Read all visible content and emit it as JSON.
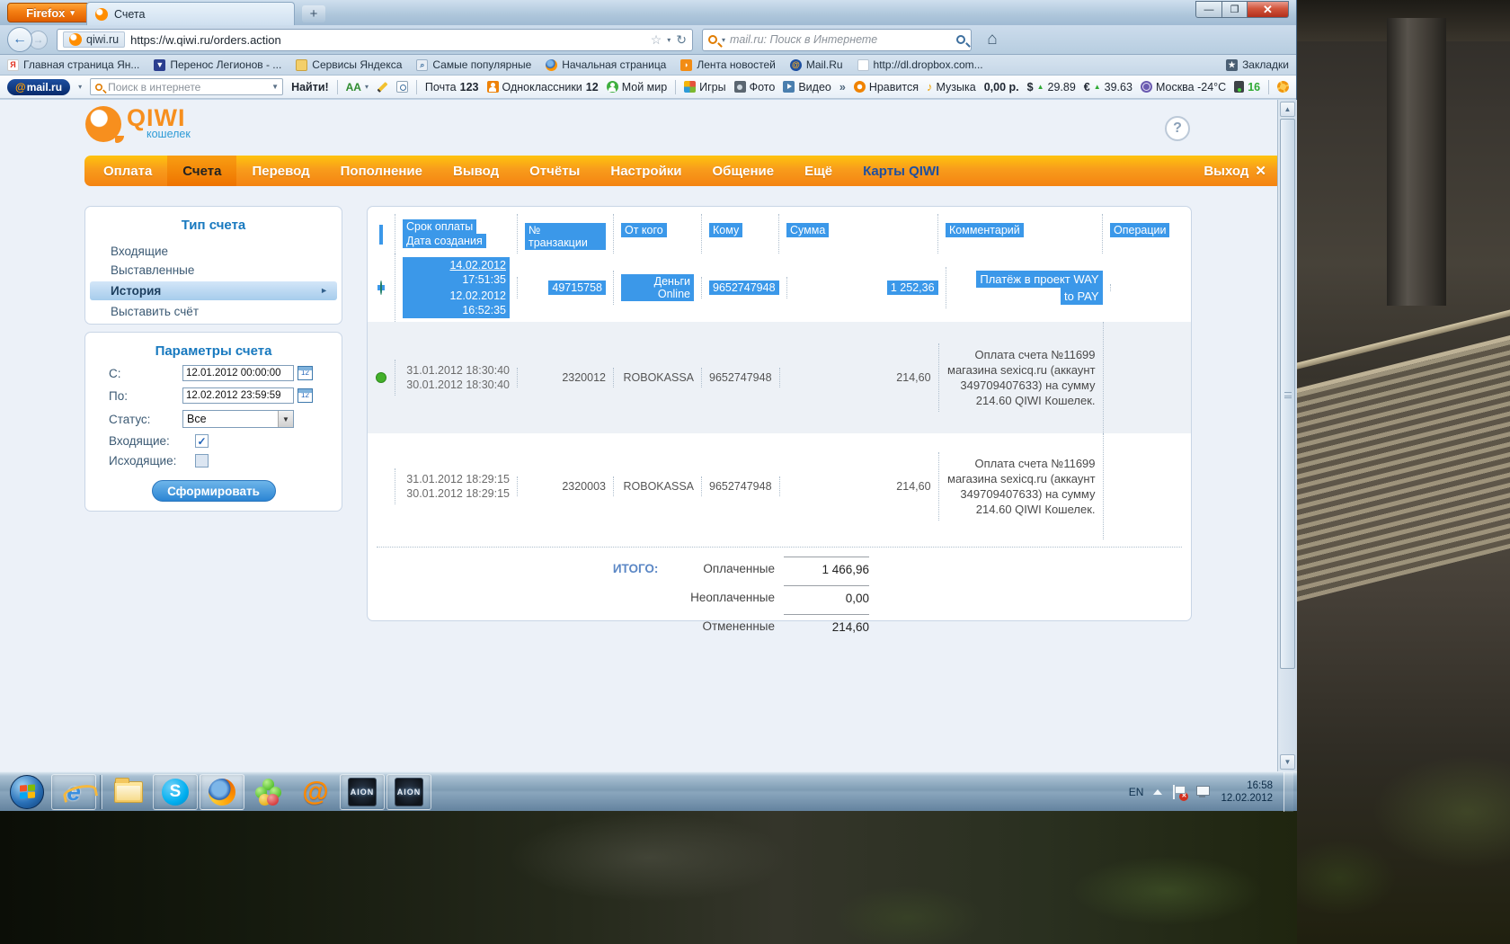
{
  "browser": {
    "menu_button": "Firefox",
    "menu_caret": "▾",
    "tab_title": "Счета",
    "new_tab": "+",
    "win_min": "—",
    "win_max": "❐",
    "win_close": "✕",
    "back": "←",
    "forward": "→",
    "url_domain": "qiwi.ru",
    "url_path": "https://w.qiwi.ru/orders.action",
    "star": "☆",
    "reload": "↻",
    "search_placeholder": "mail.ru: Поиск в Интернете",
    "home": "⌂",
    "bookmarks": [
      "Главная страница Ян...",
      "Перенос Легионов - ...",
      "Сервисы Яндекса",
      "Самые популярные",
      "Начальная страница",
      "Лента новостей",
      "Mail.Ru",
      "http://dl.dropbox.com..."
    ],
    "bookmarks_button": "Закладки"
  },
  "mailbar": {
    "logo_at": "@",
    "logo_rest": "mail.ru",
    "search_placeholder": "Поиск в интернете",
    "find": "Найти!",
    "font_icon": "AА",
    "mail": "Почта",
    "mail_count": "123",
    "ok": "Одноклассники",
    "ok_count": "12",
    "world": "Мой мир",
    "games": "Игры",
    "photo": "Фото",
    "video": "Видео",
    "more": "»",
    "like": "Нравится",
    "music": "Музыка",
    "music_note": "♪",
    "balance": "0,00 р.",
    "usd_sign": "$",
    "usd_up": "▲",
    "usd": "29.89",
    "eur_sign": "€",
    "eur_up": "▲",
    "eur": "39.63",
    "weather": "Москва -24°C",
    "traffic": "16"
  },
  "page": {
    "logo": "QIWI",
    "logo_sub": "кошелек",
    "help": "?",
    "nav": [
      "Оплата",
      "Счета",
      "Перевод",
      "Пополнение",
      "Вывод",
      "Отчёты",
      "Настройки",
      "Общение",
      "Ещё",
      "Карты QIWI"
    ],
    "logout": "Выход",
    "logout_x": "✕",
    "sidebar": {
      "type_title": "Тип счета",
      "type_items": [
        "Входящие",
        "Выставленные",
        "История",
        "Выставить счёт"
      ],
      "params_title": "Параметры счета",
      "from_label": "С:",
      "from_value": "12.01.2012 00:00:00",
      "to_label": "По:",
      "to_value": "12.02.2012 23:59:59",
      "status_label": "Статус:",
      "status_value": "Все",
      "select_caret": "▼",
      "in_label": "Входящие:",
      "check_mark": "✓",
      "out_label": "Исходящие:",
      "submit": "Сформировать",
      "cal": "12"
    },
    "table": {
      "h_due": "Срок оплаты",
      "h_created": "Дата создания",
      "h_tx": "№ транзакции",
      "h_from": "От кого",
      "h_to": "Кому",
      "h_sum": "Сумма",
      "h_comment": "Комментарий",
      "h_ops": "Операции",
      "rows": [
        {
          "due_date": "14.02.2012",
          "due_time": "17:51:35",
          "created": "12.02.2012 16:52:35",
          "tx": "49715758",
          "from": "Деньги Online",
          "to": "9652747948",
          "sum": "1 252,36",
          "comment1": "Платёж в проект WAY",
          "comment2": "to PAY"
        },
        {
          "due": "31.01.2012 18:30:40",
          "created": "30.01.2012 18:30:40",
          "tx": "2320012",
          "from": "ROBOKASSA",
          "to": "9652747948",
          "sum": "214,60",
          "comment": "Оплата счета №11699 магазина sexicq.ru (аккаунт 349709407633) на сумму 214.60 QIWI Кошелек."
        },
        {
          "due": "31.01.2012 18:29:15",
          "created": "30.01.2012 18:29:15",
          "tx": "2320003",
          "from": "ROBOKASSA",
          "to": "9652747948",
          "sum": "214,60",
          "comment": "Оплата счета №11699 магазина sexicq.ru (аккаунт 349709407633) на сумму 214.60 QIWI Кошелек."
        }
      ],
      "totals_label": "ИТОГО:",
      "totals": [
        {
          "label": "Оплаченные",
          "value": "1 466,96"
        },
        {
          "label": "Неоплаченные",
          "value": "0,00"
        },
        {
          "label": "Отмененные",
          "value": "214,60"
        }
      ]
    },
    "colors": {
      "accent_orange": "#f78f1e",
      "selection_blue": "#3b98e9",
      "link_blue": "#1879bf"
    }
  },
  "taskbar": {
    "lang": "EN",
    "time": "16:58",
    "date": "12.02.2012"
  }
}
